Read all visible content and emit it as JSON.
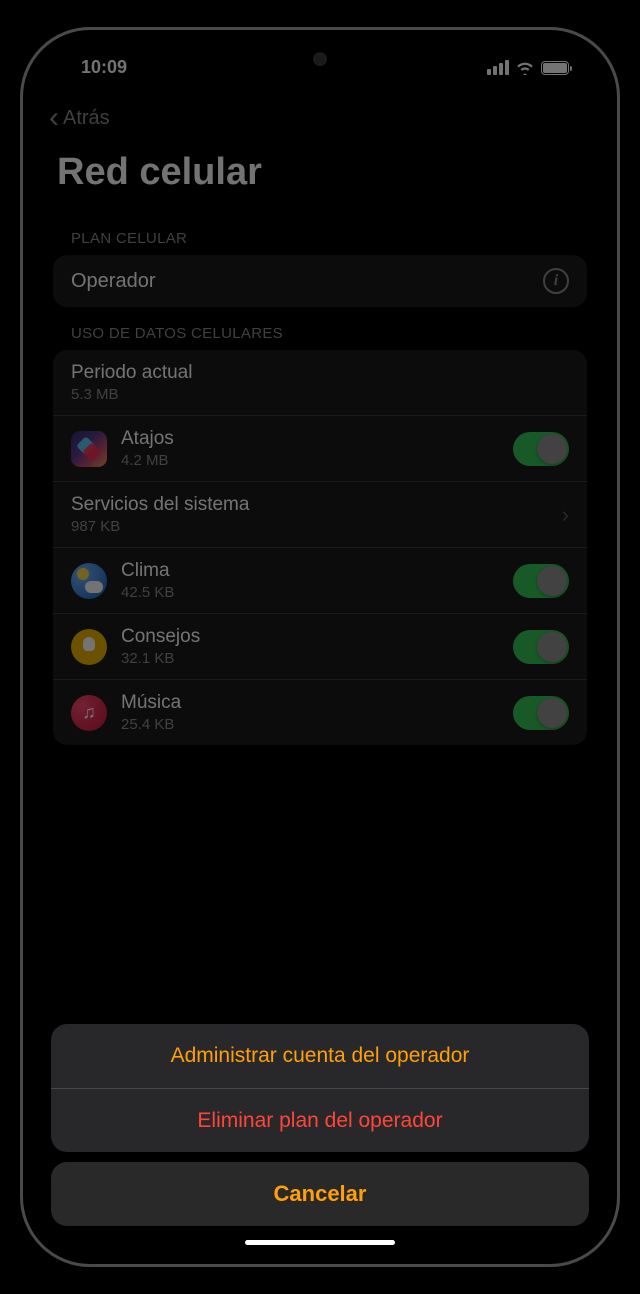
{
  "status": {
    "time": "10:09"
  },
  "nav": {
    "back_label": "Atrás"
  },
  "page": {
    "title": "Red celular"
  },
  "plan_section": {
    "header": "PLAN CELULAR",
    "carrier_label": "Operador"
  },
  "usage_section": {
    "header": "USO DE DATOS CELULARES",
    "current_period": {
      "label": "Periodo actual",
      "value": "5.3 MB"
    },
    "system_services": {
      "label": "Servicios del sistema",
      "value": "987 KB"
    },
    "apps": [
      {
        "name": "Atajos",
        "usage": "4.2 MB",
        "icon": "shortcuts",
        "toggle": true
      },
      {
        "name": "Clima",
        "usage": "42.5 KB",
        "icon": "weather",
        "toggle": true
      },
      {
        "name": "Consejos",
        "usage": "32.1 KB",
        "icon": "tips",
        "toggle": true
      },
      {
        "name": "Música",
        "usage": "25.4 KB",
        "icon": "music",
        "toggle": true
      }
    ]
  },
  "action_sheet": {
    "manage": "Administrar cuenta del operador",
    "remove": "Eliminar plan del operador",
    "cancel": "Cancelar"
  }
}
